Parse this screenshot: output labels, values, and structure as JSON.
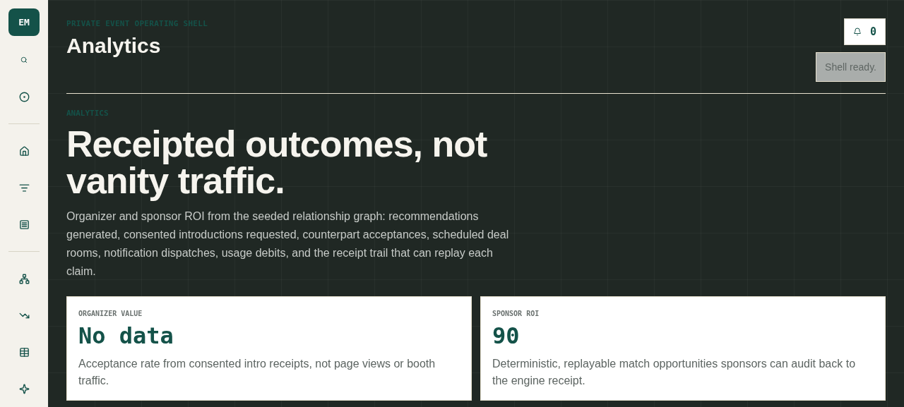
{
  "sidebar": {
    "avatar": "EM",
    "groups": [
      [
        {
          "kind": "search",
          "selected": false
        },
        {
          "kind": "radar",
          "selected": false
        }
      ],
      [
        {
          "kind": "home",
          "selected": false
        },
        {
          "kind": "filter",
          "selected": false
        },
        {
          "kind": "list",
          "selected": false
        }
      ],
      [
        {
          "kind": "nodes",
          "selected": false
        },
        {
          "kind": "trend",
          "selected": false
        },
        {
          "kind": "table",
          "selected": false
        },
        {
          "kind": "sparkle",
          "selected": false
        }
      ]
    ]
  },
  "header": {
    "eyebrow": "PRIVATE EVENT OPERATING SHELL",
    "title": "Analytics",
    "notifications": "0",
    "status": "Shell ready."
  },
  "section": {
    "eyebrow": "ANALYTICS",
    "heading": "Receipted outcomes, not vanity traffic.",
    "description": "Organizer and sponsor ROI from the seeded relationship graph: recommendations generated, consented introductions requested, counterpart acceptances, scheduled deal rooms, notification dispatches, usage debits, and the receipt trail that can replay each claim."
  },
  "cards": [
    {
      "label": "ORGANIZER VALUE",
      "value": "No data",
      "note": "Acceptance rate from consented intro receipts, not page views or booth traffic."
    },
    {
      "label": "SPONSOR ROI",
      "value": "90",
      "note": "Deterministic, replayable match opportunities sponsors can audit back to the engine receipt."
    }
  ]
}
